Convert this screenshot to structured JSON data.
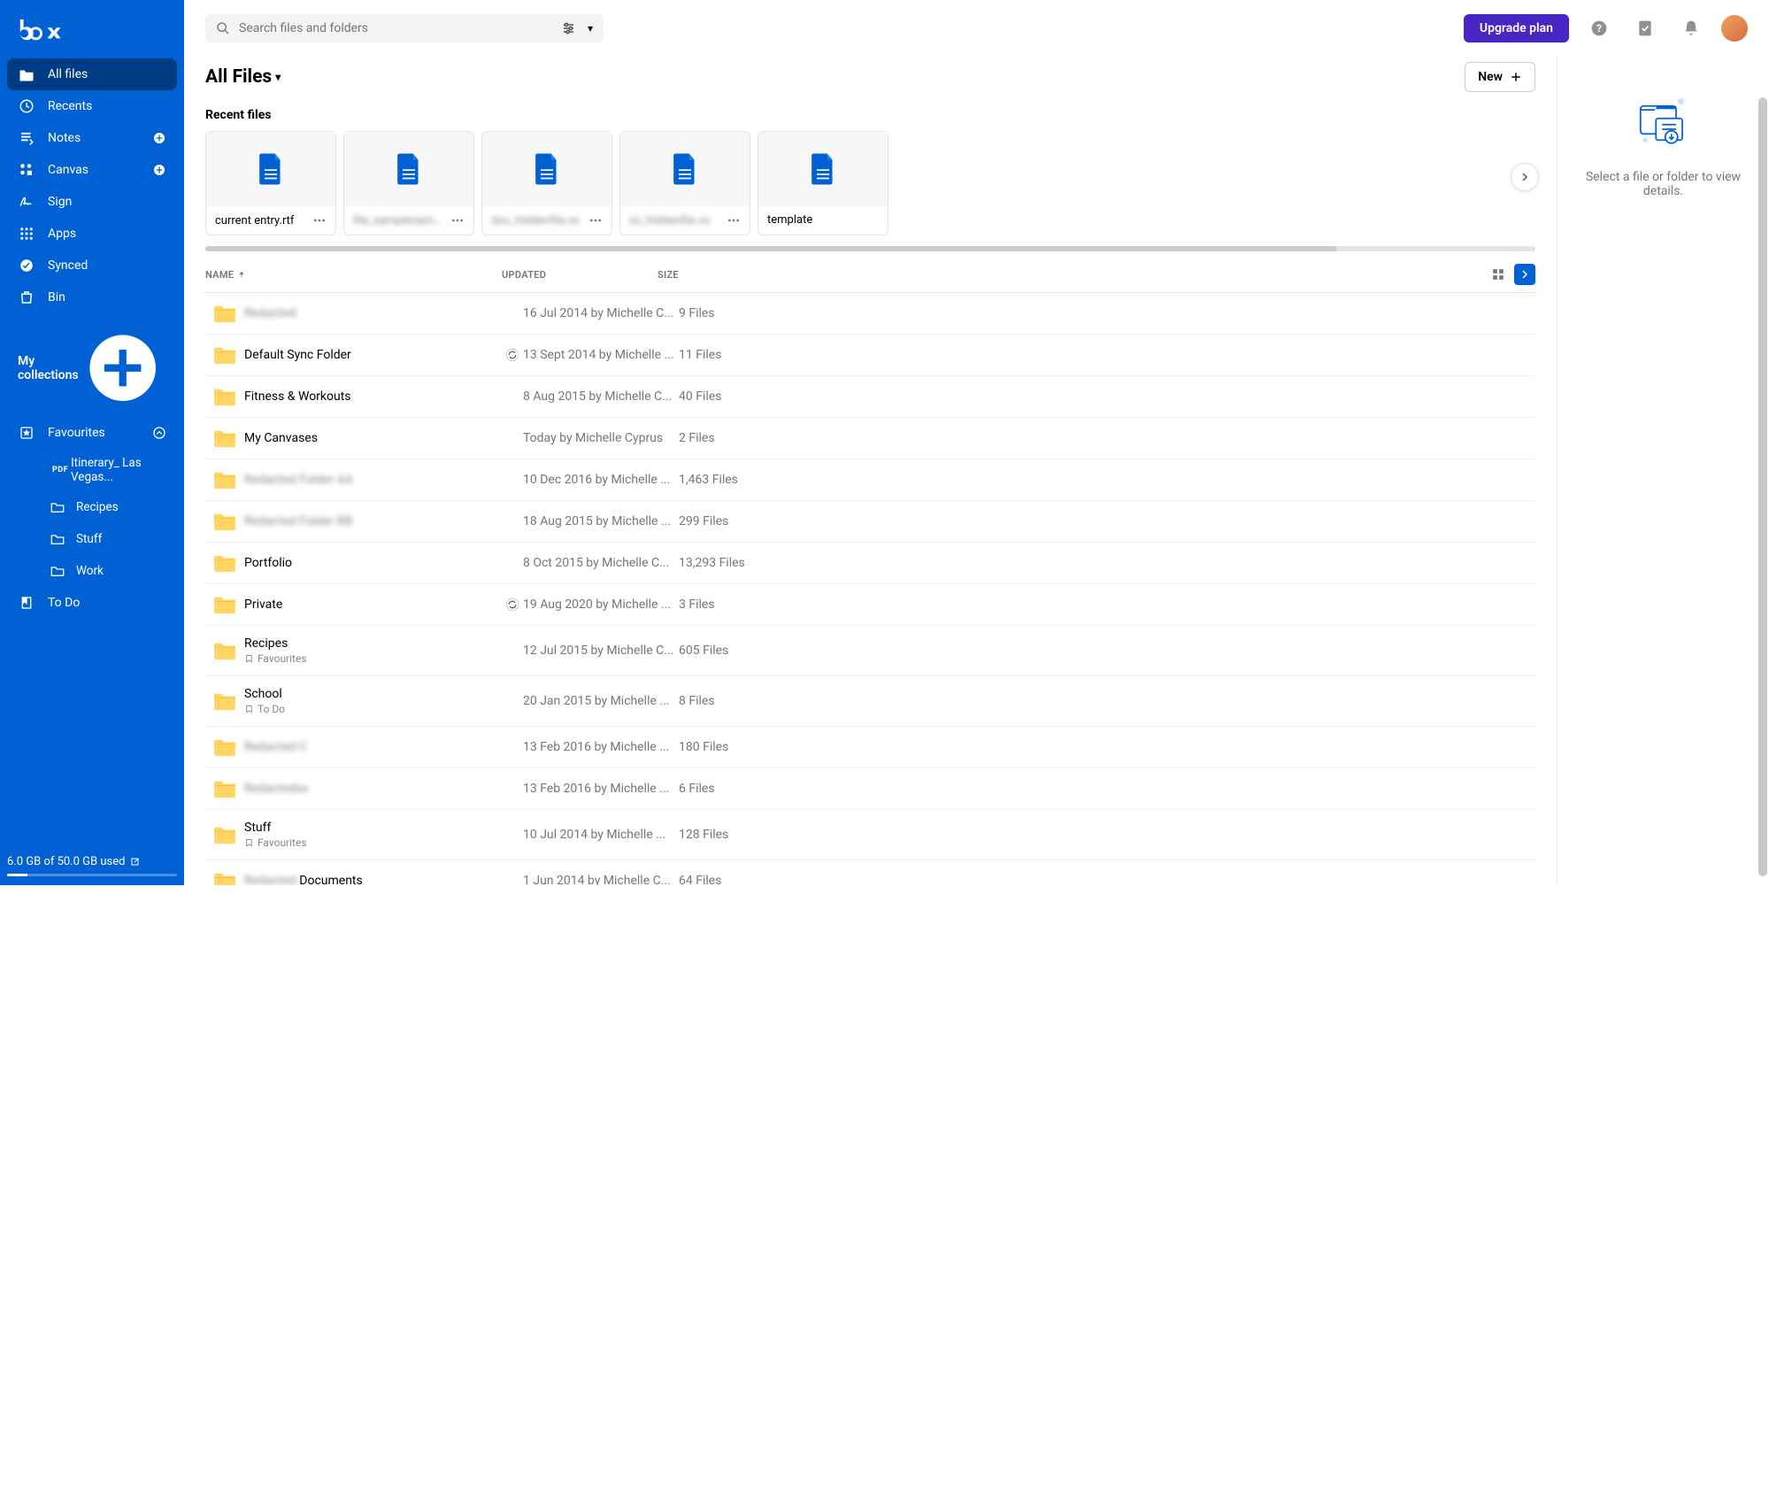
{
  "brand": "box",
  "sidebar": {
    "items": [
      {
        "label": "All files",
        "icon": "folder",
        "active": true
      },
      {
        "label": "Recents",
        "icon": "clock"
      },
      {
        "label": "Notes",
        "icon": "notes",
        "add": true
      },
      {
        "label": "Canvas",
        "icon": "canvas",
        "add": true
      },
      {
        "label": "Sign",
        "icon": "sign"
      },
      {
        "label": "Apps",
        "icon": "apps"
      },
      {
        "label": "Synced",
        "icon": "check-circle"
      },
      {
        "label": "Bin",
        "icon": "trash"
      }
    ],
    "collections_label": "My collections",
    "favourites_label": "Favourites",
    "fav_items": [
      {
        "label": "Itinerary_ Las Vegas...",
        "icon": "pdf"
      },
      {
        "label": "Recipes",
        "icon": "folder-outline"
      },
      {
        "label": "Stuff",
        "icon": "folder-outline"
      },
      {
        "label": "Work",
        "icon": "folder-outline"
      }
    ],
    "todo_label": "To Do"
  },
  "storage": {
    "text": "6.0 GB of 50.0 GB used"
  },
  "search": {
    "placeholder": "Search files and folders"
  },
  "upgrade_label": "Upgrade plan",
  "title": "All Files",
  "new_label": "New",
  "recent_label": "Recent files",
  "recent": [
    {
      "name": "current entry.rtf",
      "blurred": false
    },
    {
      "name": "file_samplename.xx",
      "blurred": true
    },
    {
      "name": "doc_hiddenfile.xx",
      "blurred": true
    },
    {
      "name": "xx_hiddenfile.xx",
      "blurred": true
    },
    {
      "name": "template",
      "blurred": false
    }
  ],
  "columns": {
    "name": "NAME",
    "updated": "UPDATED",
    "size": "SIZE"
  },
  "rows": [
    {
      "name": "Redacted",
      "blurred": true,
      "updated": "16 Jul 2014 by Michelle C...",
      "size": "9 Files"
    },
    {
      "name": "Default Sync Folder",
      "sync": true,
      "updated": "13 Sept 2014 by Michelle ...",
      "size": "11 Files"
    },
    {
      "name": "Fitness & Workouts",
      "updated": "8 Aug 2015 by Michelle C...",
      "size": "40 Files"
    },
    {
      "name": "My Canvases",
      "updated": "Today by Michelle Cyprus",
      "size": "2 Files"
    },
    {
      "name": "Redacted Folder AA",
      "blurred": true,
      "updated": "10 Dec 2016 by Michelle ...",
      "size": "1,463 Files"
    },
    {
      "name": "Redacted Folder BB",
      "blurred": true,
      "updated": "18 Aug 2015 by Michelle ...",
      "size": "299 Files"
    },
    {
      "name": "Portfolio",
      "updated": "8 Oct 2015 by Michelle C...",
      "size": "13,293 Files"
    },
    {
      "name": "Private",
      "sync": true,
      "updated": "19 Aug 2020 by Michelle ...",
      "size": "3 Files"
    },
    {
      "name": "Recipes",
      "tag": "Favourites",
      "updated": "12 Jul 2015 by Michelle C...",
      "size": "605 Files"
    },
    {
      "name": "School",
      "tag": "To Do",
      "updated": "20 Jan 2015 by Michelle ...",
      "size": "8 Files"
    },
    {
      "name": "Redacted C",
      "blurred": true,
      "updated": "13 Feb 2016 by Michelle ...",
      "size": "180 Files"
    },
    {
      "name": "Redactedxx",
      "blurred": true,
      "updated": "13 Feb 2016 by Michelle ...",
      "size": "6 Files"
    },
    {
      "name": "Stuff",
      "tag": "Favourites",
      "updated": "10 Jul 2014 by Michelle ...",
      "size": "128 Files"
    },
    {
      "name": "Redacted Documents",
      "partial_blur": true,
      "updated": "1 Jun 2014 by Michelle C...",
      "size": "64 Files"
    }
  ],
  "details_text": "Select a file or folder to view details."
}
